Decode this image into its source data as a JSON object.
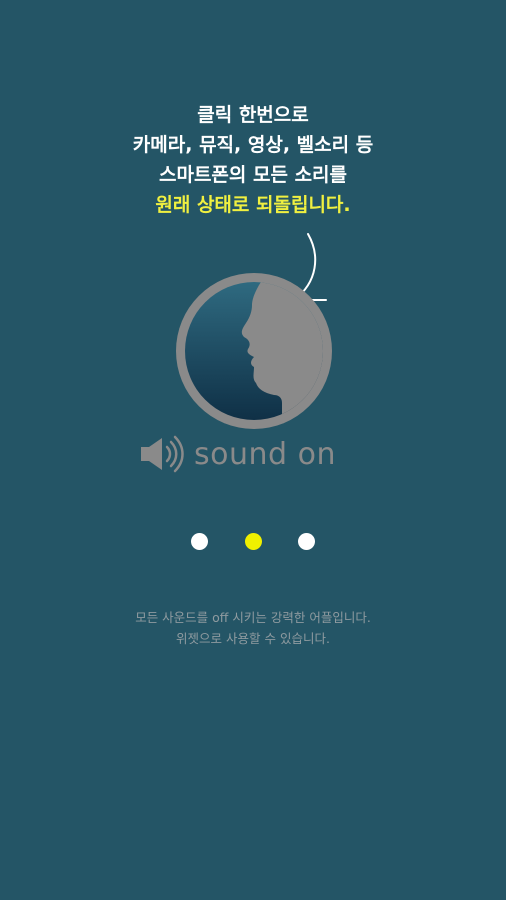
{
  "headline": {
    "line1": "클릭 한번으로",
    "line2": "카메라, 뮤직, 영상, 벨소리 등",
    "line3": "스마트폰의 모든 소리를",
    "line4_accent": "원래 상태로 되돌립니다."
  },
  "illustration": {
    "icon": "face-profile-icon",
    "arrow_icon": "curved-arrow-icon"
  },
  "sound_toggle": {
    "icon": "speaker-icon",
    "label": "sound on"
  },
  "pager": {
    "count": 3,
    "active_index": 1,
    "active_color": "#f0f000",
    "inactive_color": "#ffffff"
  },
  "footer": {
    "line1": "모든 사운드를 off 시키는 강력한 어플입니다.",
    "line2": "위젯으로 사용할 수 있습니다."
  },
  "colors": {
    "background": "#245566",
    "accent": "#f0f040",
    "ring": "#8a8a8a"
  }
}
